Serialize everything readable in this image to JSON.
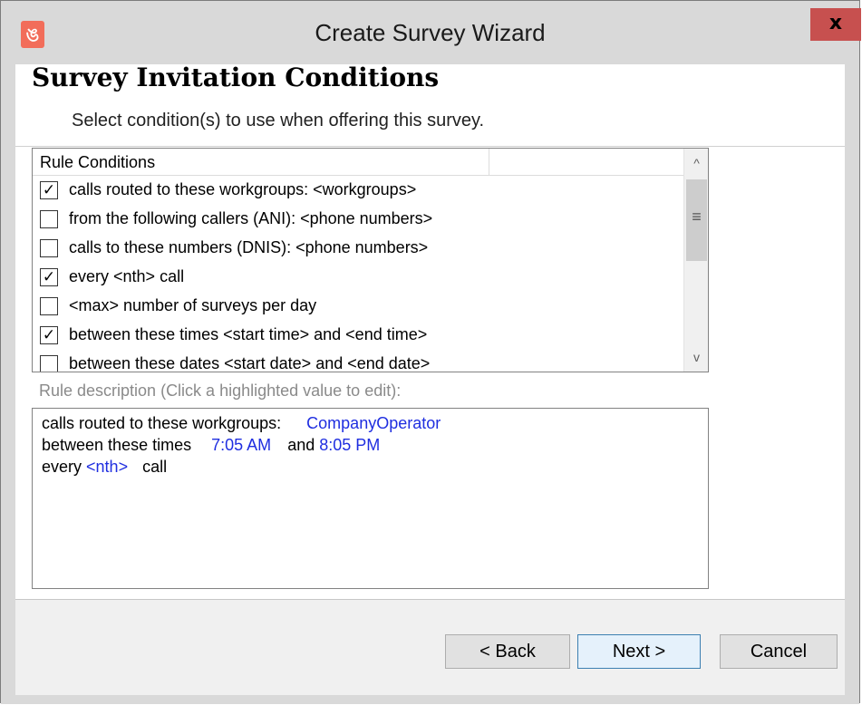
{
  "window": {
    "title": "Create Survey Wizard",
    "close_glyph": "x",
    "app_icon_glyph": "ঙ"
  },
  "page": {
    "heading": "Survey Invitation Conditions",
    "subheading": "Select condition(s) to use when offering this survey."
  },
  "conditions": {
    "header": "Rule Conditions",
    "items": [
      {
        "label": "calls routed to these workgroups: <workgroups>",
        "checked": true
      },
      {
        "label": "from the following callers (ANI): <phone numbers>",
        "checked": false
      },
      {
        "label": "calls to these numbers (DNIS): <phone numbers>",
        "checked": false
      },
      {
        "label": "every <nth> call",
        "checked": true
      },
      {
        "label": "<max> number of surveys per day",
        "checked": false
      },
      {
        "label": "between these times <start time> and <end time>",
        "checked": true
      },
      {
        "label": "between these dates <start date> and <end date>",
        "checked": false
      }
    ],
    "scroll_up_glyph": "^",
    "scroll_down_glyph": "v",
    "scroll_grip_glyph": "≡"
  },
  "description": {
    "label": "Rule description (Click a highlighted value to edit):",
    "lines": [
      {
        "prefix": "calls routed to these workgroups:",
        "value1": "CompanyOperator",
        "middle": "",
        "value2": "",
        "suffix": ""
      },
      {
        "prefix": "between these times",
        "value1": "7:05 AM",
        "middle": "and",
        "value2": "8:05 PM",
        "suffix": ""
      },
      {
        "prefix": "every",
        "value1": "<nth>",
        "middle": "",
        "value2": "",
        "suffix": "call"
      }
    ]
  },
  "buttons": {
    "back": "< Back",
    "next": "Next >",
    "cancel": "Cancel"
  },
  "colors": {
    "titlebar": "#d9d9d9",
    "close": "#c7504f",
    "link_value": "#1f2ee0",
    "accent_icon": "#f26d5a"
  }
}
